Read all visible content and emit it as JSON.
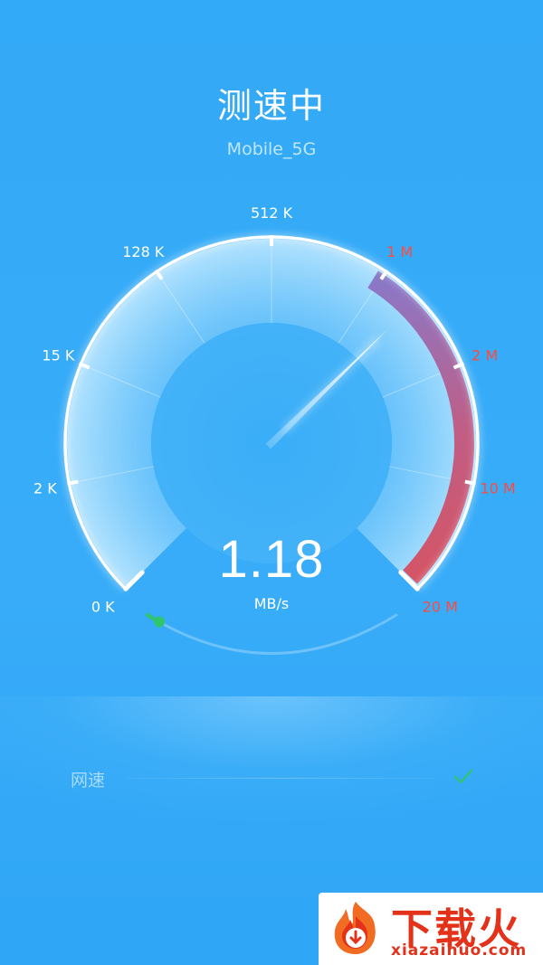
{
  "header": {
    "title": "测速中",
    "network_name": "Mobile_5G"
  },
  "gauge": {
    "scale_labels": [
      "0 K",
      "2 K",
      "15 K",
      "128 K",
      "512 K",
      "1 M",
      "2 M",
      "10 M",
      "20 M"
    ],
    "danger_from_index": 5,
    "current_speed_value": "1.18",
    "current_speed_unit": "MB/s",
    "needle_position": 5.35,
    "progress_fraction": 0.04
  },
  "results": {
    "rows": [
      {
        "label": "网速",
        "status": "done"
      }
    ]
  },
  "watermark": {
    "brand": "下载火",
    "url": "xiazaihuo.com"
  },
  "colors": {
    "background": "#33aaf7",
    "normal_label": "#ffffff",
    "danger_label": "#ff4a3d",
    "danger_arc": "#c2607a",
    "progress_dot": "#2fc56a",
    "brand_red": "#e4321a"
  }
}
